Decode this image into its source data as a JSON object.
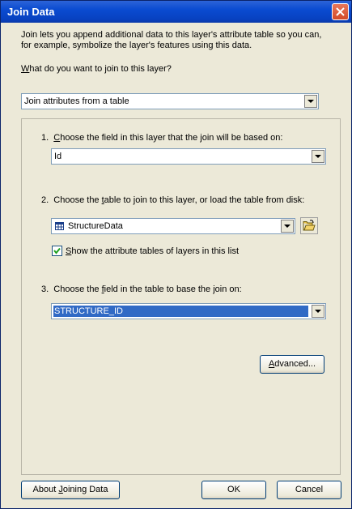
{
  "window": {
    "title": "Join Data"
  },
  "intro": {
    "line1": "Join lets you append additional data to this layer's attribute table so you can,",
    "line2": "for example, symbolize the layer's features using this data."
  },
  "question": {
    "label_ul": "W",
    "label_rest": "hat do you want to join to this layer?"
  },
  "join_type": {
    "value": "Join attributes from a table"
  },
  "step1": {
    "prefix": "1.  ",
    "ul": "C",
    "rest": "hoose the field in this layer that the join will be based on:",
    "field_value": "Id"
  },
  "step2": {
    "prefix": "2.  Choose the ",
    "ul": "t",
    "rest": "able to join to this layer, or load the table from disk:",
    "table_value": "StructureData",
    "checkbox_ul": "S",
    "checkbox_rest": "how the attribute tables of layers in this list",
    "checkbox_checked": true
  },
  "step3": {
    "prefix": "3.  Choose the ",
    "ul": "f",
    "rest": "ield in the table to base the join on:",
    "field_value": "STRUCTURE_ID"
  },
  "buttons": {
    "advanced_ul": "A",
    "advanced_rest": "dvanced...",
    "about_pre": "About ",
    "about_ul": "J",
    "about_rest": "oining Data",
    "ok": "OK",
    "cancel": "Cancel"
  },
  "colors": {
    "titlebar": "#0a4bd1",
    "selection": "#316ac5",
    "close": "#d24a28"
  },
  "icons": [
    "close-icon",
    "chevron-down-icon",
    "table-icon",
    "open-folder-icon",
    "checkmark-icon"
  ]
}
